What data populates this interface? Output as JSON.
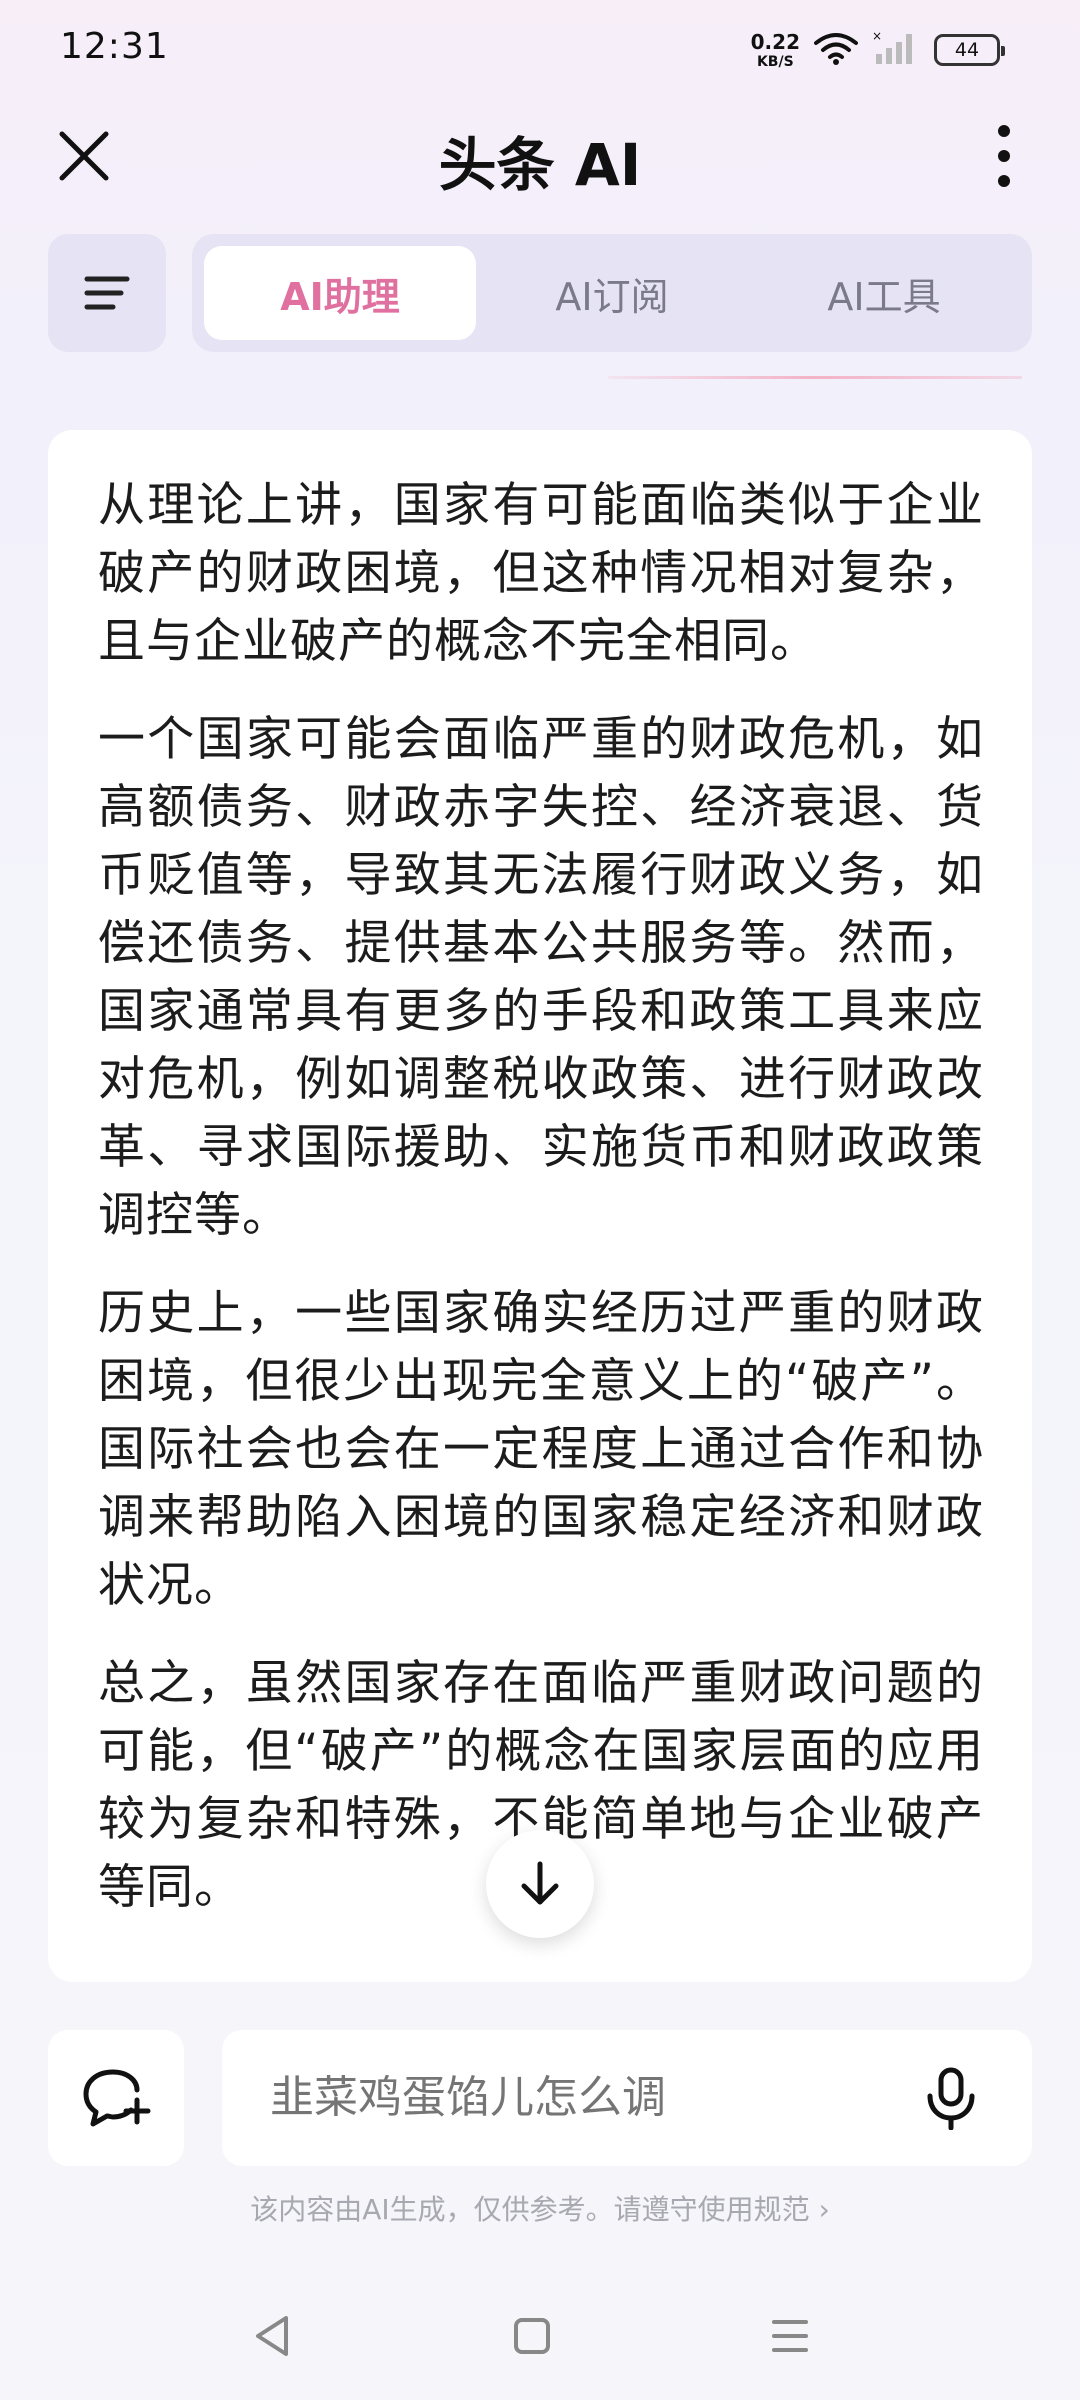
{
  "status_bar": {
    "time": "12:31",
    "net_speed_value": "0.22",
    "net_speed_unit": "KB/S",
    "battery": "44"
  },
  "header": {
    "title": "头条 AI",
    "close_icon": "close-icon",
    "more_icon": "more-vertical-icon"
  },
  "tabs": [
    {
      "label": "AI助理",
      "active": true
    },
    {
      "label": "AI订阅",
      "active": false
    },
    {
      "label": "AI工具",
      "active": false
    }
  ],
  "message": {
    "paragraphs": [
      "从理论上讲，国家有可能面临类似于企业破产的财政困境，但这种情况相对复杂，且与企业破产的概念不完全相同。",
      "一个国家可能会面临严重的财政危机，如高额债务、财政赤字失控、经济衰退、货币贬值等，导致其无法履行财政义务，如偿还债务、提供基本公共服务等。然而，国家通常具有更多的手段和政策工具来应对危机，例如调整税收政策、进行财政改革、寻求国际援助、实施货币和财政政策调控等。",
      "历史上，一些国家确实经历过严重的财政困境，但很少出现完全意义上的“破产”。国际社会也会在一定程度上通过合作和协调来帮助陷入困境的国家稳定经济和财政状况。",
      "总之，虽然国家存在面临严重财政问题的可能，但“破产”的概念在国家层面的应用较为复杂和特殊，不能简单地与企业破产等同。"
    ]
  },
  "input": {
    "placeholder": "韭菜鸡蛋馅儿怎么调"
  },
  "disclaimer": {
    "text": "该内容由AI生成，仅供参考。请遵守使用规范",
    "chevron": "›"
  },
  "colors": {
    "accent": "#e0709f",
    "tab_bg": "#e6e3f4",
    "card_bg": "#ffffff"
  }
}
